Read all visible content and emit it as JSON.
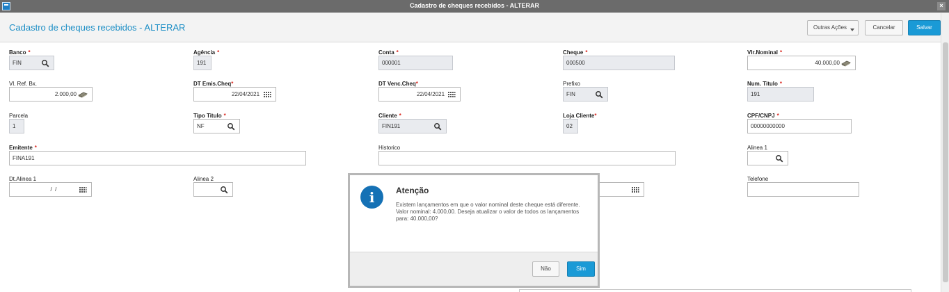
{
  "window": {
    "title": "Cadastro de cheques recebidos - ALTERAR",
    "close": "×"
  },
  "header": {
    "title": "Cadastro de cheques recebidos - ALTERAR",
    "outras_acoes": "Outras Ações",
    "cancelar": "Cancelar",
    "salvar": "Salvar"
  },
  "form": {
    "banco": {
      "label": "Banco",
      "value": "FIN"
    },
    "agencia": {
      "label": "Agência",
      "value": "191"
    },
    "conta": {
      "label": "Conta",
      "value": "000001"
    },
    "cheque": {
      "label": "Cheque",
      "value": "000500"
    },
    "vlr_nominal": {
      "label": "Vlr.Nominal",
      "value": "40.000,00"
    },
    "vl_ref_bx": {
      "label": "Vl. Ref. Bx.",
      "value": "2.000,00"
    },
    "dt_emis": {
      "label": "DT Emis.Cheq",
      "value": "22/04/2021"
    },
    "dt_venc": {
      "label": "DT Venc.Cheq",
      "value": "22/04/2021"
    },
    "prefixo": {
      "label": "Prefixo",
      "value": "FIN"
    },
    "num_titulo": {
      "label": "Num. Titulo",
      "value": "191"
    },
    "parcela": {
      "label": "Parcela",
      "value": "1"
    },
    "tipo_titulo": {
      "label": "Tipo Titulo",
      "value": "NF"
    },
    "cliente": {
      "label": "Cliente",
      "value": "FIN191"
    },
    "loja_cliente": {
      "label": "Loja Cliente",
      "value": "02"
    },
    "cpf_cnpj": {
      "label": "CPF/CNPJ",
      "value": "00000000000"
    },
    "emitente": {
      "label": "Emitente",
      "value": "FINA191"
    },
    "historico": {
      "label": "Historico",
      "value": ""
    },
    "alinea1": {
      "label": "Alinea 1",
      "value": ""
    },
    "dt_alinea1": {
      "label": "Dt.Alinea 1",
      "value": "  /  /"
    },
    "alinea2": {
      "label": "Alinea 2",
      "value": ""
    },
    "dt_alinea2": {
      "value": ""
    },
    "telefone": {
      "label": "Telefone",
      "value": ""
    },
    "required_mark": "*"
  },
  "dialog": {
    "title": "Atenção",
    "icon": "i",
    "message": "Existem lançamentos em que o valor nominal deste cheque está diferente. Valor nominal: 4.000,00. Deseja atualizar o valor de todos os lançamentos para: 40.000,00?",
    "nao": "Não",
    "sim": "Sim"
  },
  "colors": {
    "accent": "#1a9ad6",
    "title": "#1e8fc6",
    "required": "#d9251d",
    "info_icon": "#1571b5"
  },
  "icons": {
    "lookup": "search-icon",
    "money": "money-icon",
    "calendar": "calendar-icon"
  }
}
